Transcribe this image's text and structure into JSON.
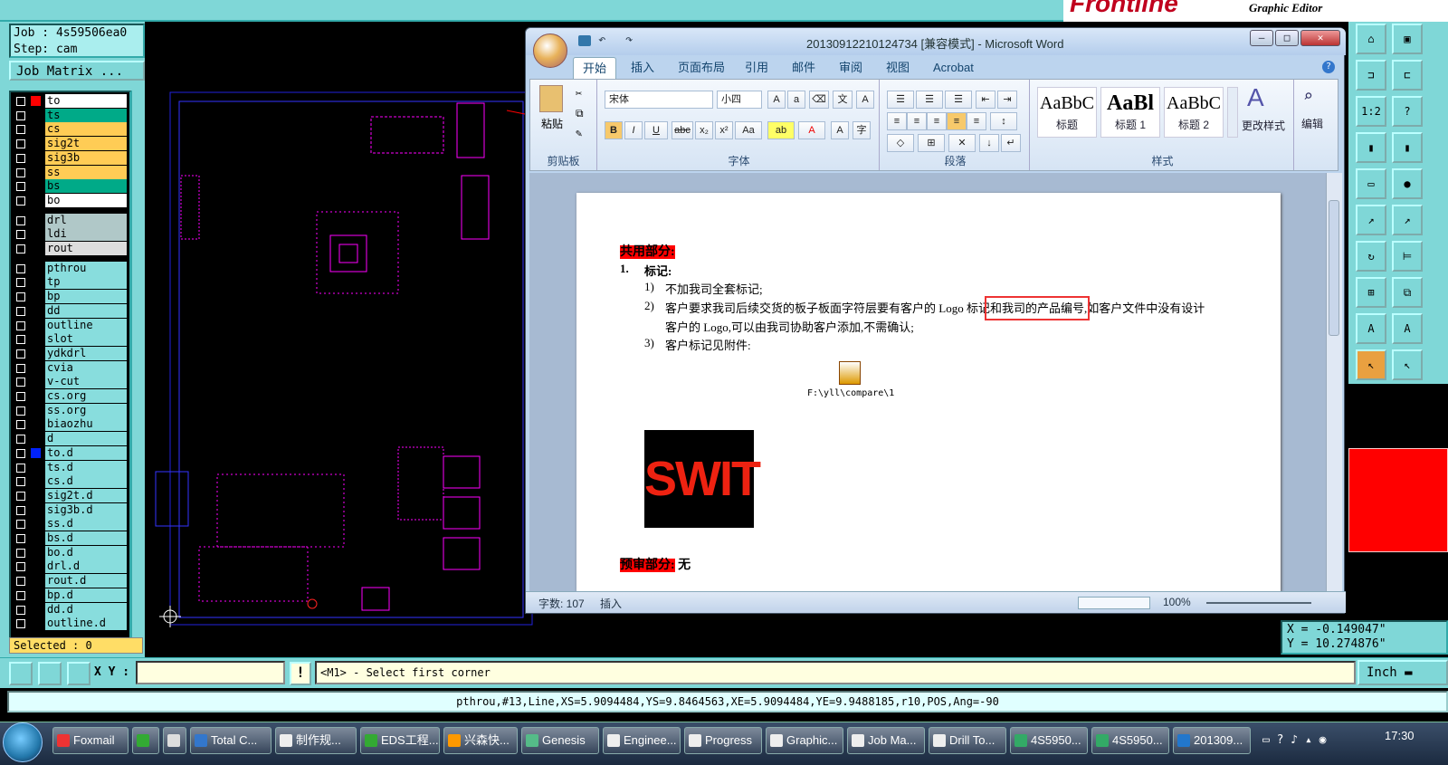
{
  "genesis": {
    "job": "Job : 4s59506ea0",
    "step": "Step: cam",
    "job_matrix": "Job Matrix ...",
    "selected": "Selected : 0",
    "layers": [
      {
        "name": "to",
        "color": "#ffffff",
        "swatch": "#ff0000"
      },
      {
        "name": "ts",
        "color": "#00aa88",
        "swatch": ""
      },
      {
        "name": "cs",
        "color": "#ffcc55",
        "swatch": ""
      },
      {
        "name": "sig2t",
        "color": "#ffcc55",
        "swatch": ""
      },
      {
        "name": "sig3b",
        "color": "#ffcc55",
        "swatch": ""
      },
      {
        "name": "ss",
        "color": "#ffcc55",
        "swatch": ""
      },
      {
        "name": "bs",
        "color": "#00aa88",
        "swatch": ""
      },
      {
        "name": "bo",
        "color": "#ffffff",
        "swatch": ""
      },
      {
        "name": "drl",
        "color": "#b0c8c8",
        "swatch": ""
      },
      {
        "name": "ldi",
        "color": "#b0c8c8",
        "swatch": ""
      },
      {
        "name": "rout",
        "color": "#dddddd",
        "swatch": ""
      },
      {
        "name": "pthrou",
        "color": "#88dddd",
        "swatch": ""
      },
      {
        "name": "tp",
        "color": "#88dddd",
        "swatch": ""
      },
      {
        "name": "bp",
        "color": "#88dddd",
        "swatch": ""
      },
      {
        "name": "dd",
        "color": "#88dddd",
        "swatch": ""
      },
      {
        "name": "outline",
        "color": "#88dddd",
        "swatch": ""
      },
      {
        "name": "slot",
        "color": "#88dddd",
        "swatch": ""
      },
      {
        "name": "ydkdrl",
        "color": "#88dddd",
        "swatch": ""
      },
      {
        "name": "cvia",
        "color": "#88dddd",
        "swatch": ""
      },
      {
        "name": "v-cut",
        "color": "#88dddd",
        "swatch": ""
      },
      {
        "name": "cs.org",
        "color": "#88dddd",
        "swatch": ""
      },
      {
        "name": "ss.org",
        "color": "#88dddd",
        "swatch": ""
      },
      {
        "name": "biaozhu",
        "color": "#88dddd",
        "swatch": ""
      },
      {
        "name": "d",
        "color": "#88dddd",
        "swatch": ""
      },
      {
        "name": "to.d",
        "color": "#88dddd",
        "swatch": "#0022ff"
      },
      {
        "name": "ts.d",
        "color": "#88dddd",
        "swatch": ""
      },
      {
        "name": "cs.d",
        "color": "#88dddd",
        "swatch": ""
      },
      {
        "name": "sig2t.d",
        "color": "#88dddd",
        "swatch": ""
      },
      {
        "name": "sig3b.d",
        "color": "#88dddd",
        "swatch": ""
      },
      {
        "name": "ss.d",
        "color": "#88dddd",
        "swatch": ""
      },
      {
        "name": "bs.d",
        "color": "#88dddd",
        "swatch": ""
      },
      {
        "name": "bo.d",
        "color": "#88dddd",
        "swatch": ""
      },
      {
        "name": "drl.d",
        "color": "#88dddd",
        "swatch": ""
      },
      {
        "name": "rout.d",
        "color": "#88dddd",
        "swatch": ""
      },
      {
        "name": "bp.d",
        "color": "#88dddd",
        "swatch": ""
      },
      {
        "name": "dd.d",
        "color": "#88dddd",
        "swatch": ""
      },
      {
        "name": "outline.d",
        "color": "#88dddd",
        "swatch": ""
      }
    ],
    "xy_label": "X Y :",
    "xy_value": "",
    "prompt": "<M1> - Select first corner",
    "unit": "Inch",
    "coord_x": "X = -0.149047\"",
    "coord_y": "Y = 10.274876\"",
    "info": "pthrou,#13,Line,XS=5.9094484,YS=9.8464563,XE=5.9094484,YE=9.9488185,r10,POS,Ang=-90",
    "brand": "Frontline",
    "brand_sub": "Graphic Editor"
  },
  "word": {
    "title": "20130912210124734 [兼容模式] - Microsoft Word",
    "tabs": [
      "开始",
      "插入",
      "页面布局",
      "引用",
      "邮件",
      "审阅",
      "视图",
      "Acrobat"
    ],
    "font_name": "宋体",
    "font_size": "小四",
    "groups": {
      "clipboard": "剪贴板",
      "font": "字体",
      "paragraph": "段落",
      "styles": "样式"
    },
    "paste": "粘贴",
    "styles": [
      {
        "preview": "AaBbC",
        "name": "标题"
      },
      {
        "preview": "AaBl",
        "name": "标题 1"
      },
      {
        "preview": "AaBbC",
        "name": "标题 2"
      }
    ],
    "change_styles": "更改样式",
    "edit": "编辑",
    "doc": {
      "h1": "共用部分:",
      "item1": "1.",
      "item1_text": "标记:",
      "sub1": "1)",
      "sub1_text": "不加我司全套标记;",
      "sub2": "2)",
      "sub2_text_a": "客户要求我司后续交货的板子板面字符层要有客户的 Logo 标记",
      "sub2_text_box": "和我司的产品编号",
      "sub2_text_b": ",如客户文件中没有设计",
      "sub2_line2": "客户的 Logo,可以由我司协助客户添加,不需确认;",
      "sub3": "3)",
      "sub3_text": "客户标记见附件:",
      "attach": "F:\\yll\\compare\\1",
      "logo": "SWIT",
      "h2": "预审部分:",
      "h2_tail": "无"
    },
    "status_words": "字数: 107",
    "status_mode": "插入",
    "zoom": "100%"
  },
  "taskbar": {
    "items": [
      {
        "label": "Foxmail",
        "color": "#e33"
      },
      {
        "label": "",
        "color": "#3a3"
      },
      {
        "label": "",
        "color": "#ddd"
      },
      {
        "label": "Total C...",
        "color": "#37c"
      },
      {
        "label": "制作规...",
        "color": "#eee"
      },
      {
        "label": "EDS工程...",
        "color": "#3a3"
      },
      {
        "label": "兴森快...",
        "color": "#f90"
      },
      {
        "label": "Genesis",
        "color": "#5b8"
      },
      {
        "label": "Enginee...",
        "color": "#eee"
      },
      {
        "label": "Progress",
        "color": "#eee"
      },
      {
        "label": "Graphic...",
        "color": "#eee"
      },
      {
        "label": "Job Ma...",
        "color": "#eee"
      },
      {
        "label": "Drill To...",
        "color": "#eee"
      },
      {
        "label": "4S5950...",
        "color": "#3a6"
      },
      {
        "label": "4S5950...",
        "color": "#3a6"
      },
      {
        "label": "201309...",
        "color": "#27c"
      }
    ],
    "clock": "17:30"
  }
}
